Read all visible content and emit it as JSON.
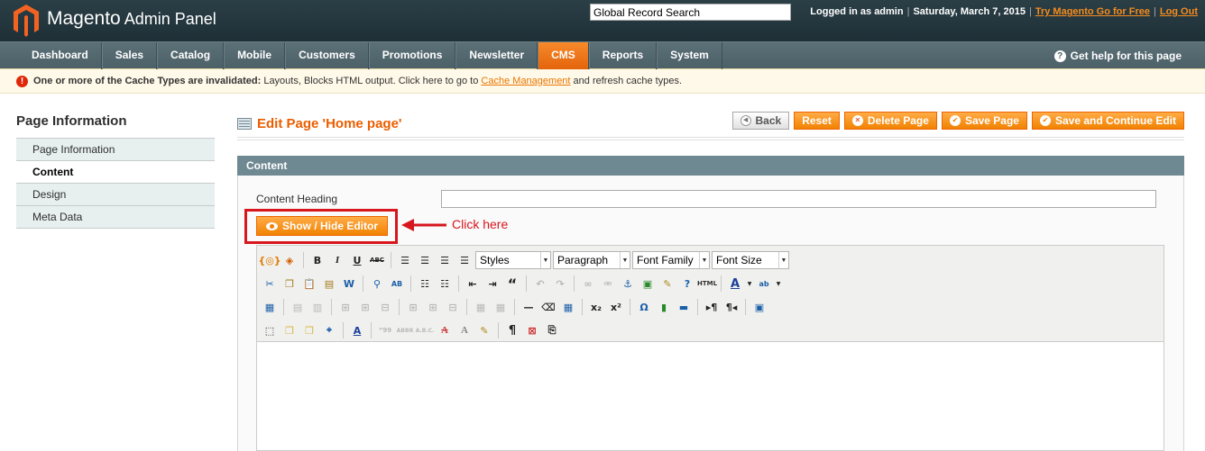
{
  "header": {
    "brand_main": "Magento",
    "brand_sub": "Admin Panel",
    "search_value": "Global Record Search",
    "logged_in": "Logged in as admin",
    "date": "Saturday, March 7, 2015",
    "try_link": "Try Magento Go for Free",
    "logout": "Log Out"
  },
  "nav": {
    "items": [
      "Dashboard",
      "Sales",
      "Catalog",
      "Mobile",
      "Customers",
      "Promotions",
      "Newsletter",
      "CMS",
      "Reports",
      "System"
    ],
    "active": "CMS",
    "help": "Get help for this page"
  },
  "notice": {
    "bold": "One or more of the Cache Types are invalidated:",
    "text1": " Layouts, Blocks HTML output. Click here to go to ",
    "link": "Cache Management",
    "text2": " and refresh cache types."
  },
  "sidebar": {
    "title": "Page Information",
    "tabs": [
      "Page Information",
      "Content",
      "Design",
      "Meta Data"
    ],
    "active": "Content"
  },
  "main": {
    "title": "Edit Page 'Home page'",
    "buttons": {
      "back": "Back",
      "reset": "Reset",
      "delete": "Delete Page",
      "save": "Save Page",
      "save_continue": "Save and Continue Edit"
    },
    "section": "Content",
    "content_heading_label": "Content Heading",
    "content_heading_value": "",
    "show_hide": "Show / Hide Editor",
    "annotation": "Click here"
  },
  "editor": {
    "selects": {
      "styles": "Styles",
      "format": "Paragraph",
      "font_family": "Font Family",
      "font_size": "Font Size"
    },
    "icon_html": "HTML"
  },
  "colors": {
    "accent_orange": "#f18200",
    "annotation_red": "#d7161e",
    "nav_bg": "#536870",
    "section_bg": "#6f8992"
  }
}
